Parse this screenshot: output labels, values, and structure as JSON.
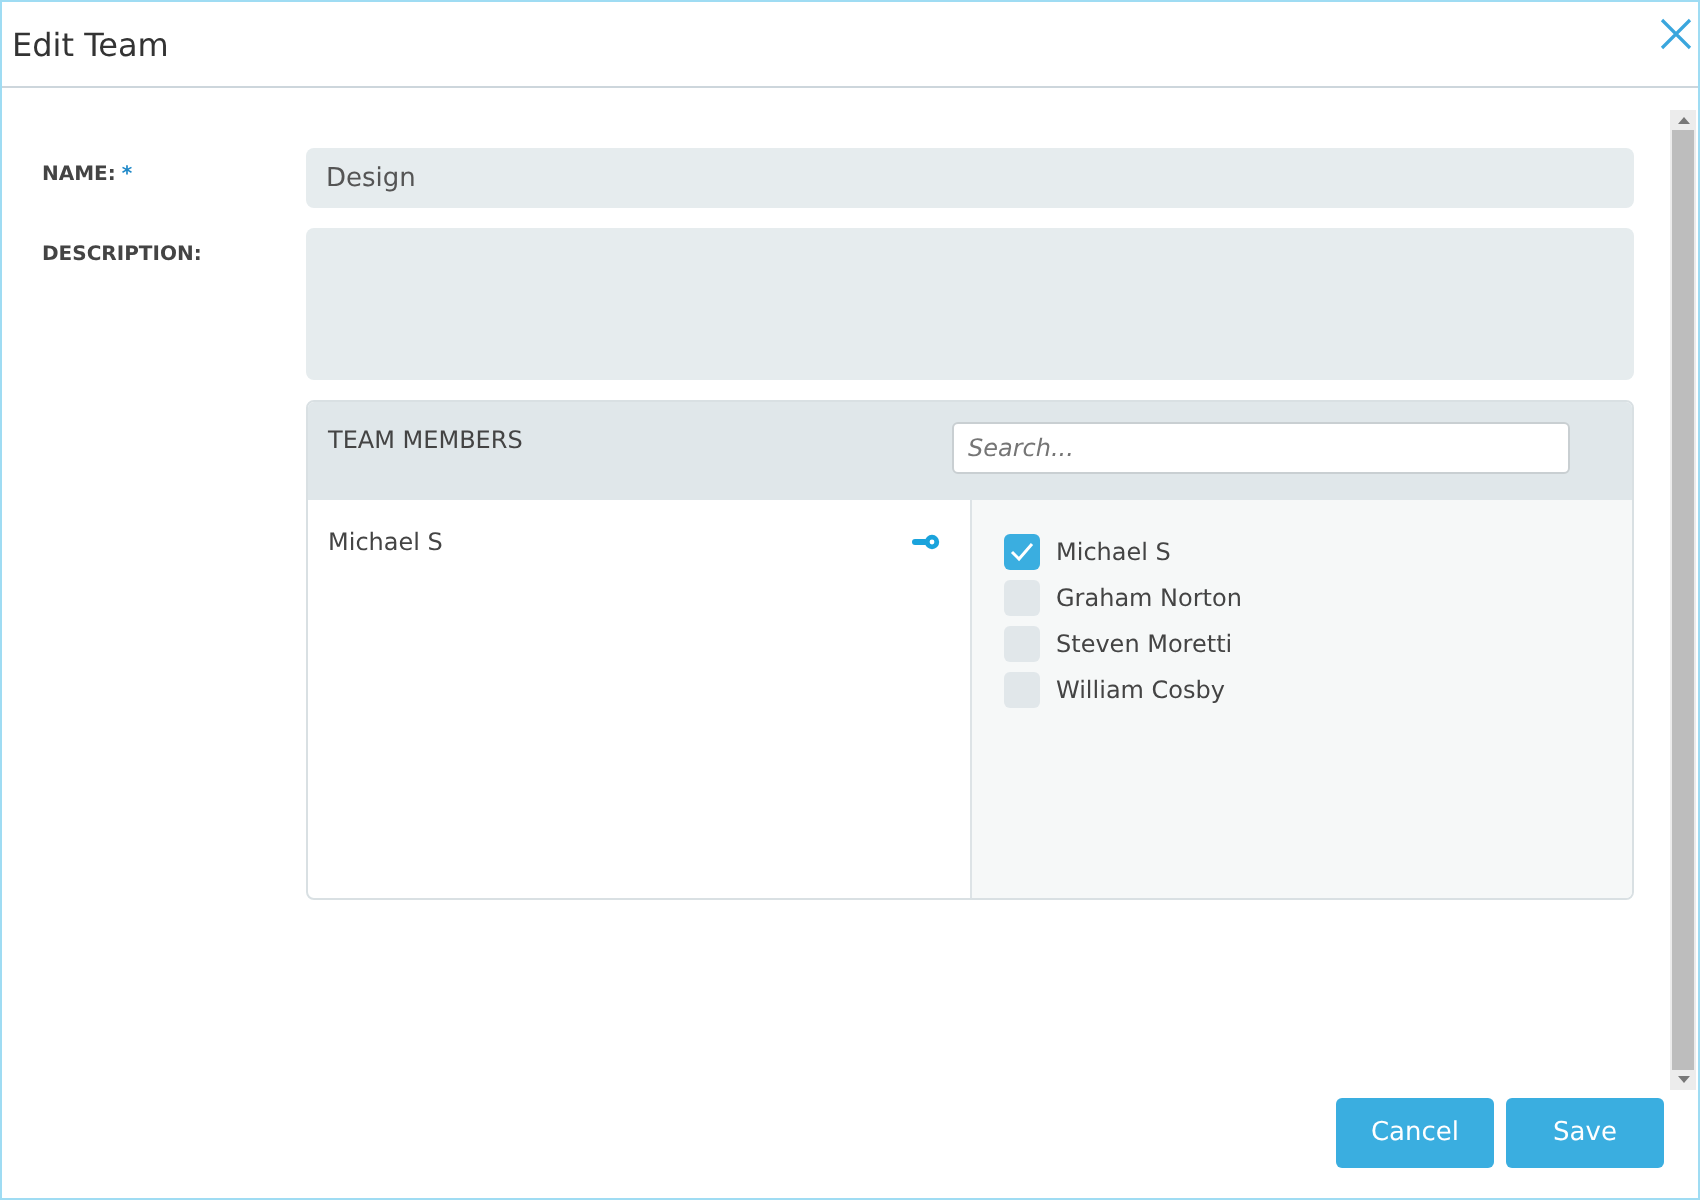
{
  "window": {
    "title": "Edit Team"
  },
  "form": {
    "name_label": "NAME:",
    "required_mark": "*",
    "name_value": "Design",
    "description_label": "DESCRIPTION:"
  },
  "team_members": {
    "title": "TEAM MEMBERS",
    "search": {
      "placeholder": "Search..."
    },
    "members": [
      {
        "name": "Michael S"
      }
    ],
    "candidates": [
      {
        "name": "Michael S",
        "checked": true
      },
      {
        "name": "Graham Norton",
        "checked": false
      },
      {
        "name": "Steven Moretti",
        "checked": false
      },
      {
        "name": "William Cosby",
        "checked": false
      }
    ]
  },
  "buttons": [
    {
      "label": "Cancel"
    },
    {
      "label": "Save"
    }
  ]
}
